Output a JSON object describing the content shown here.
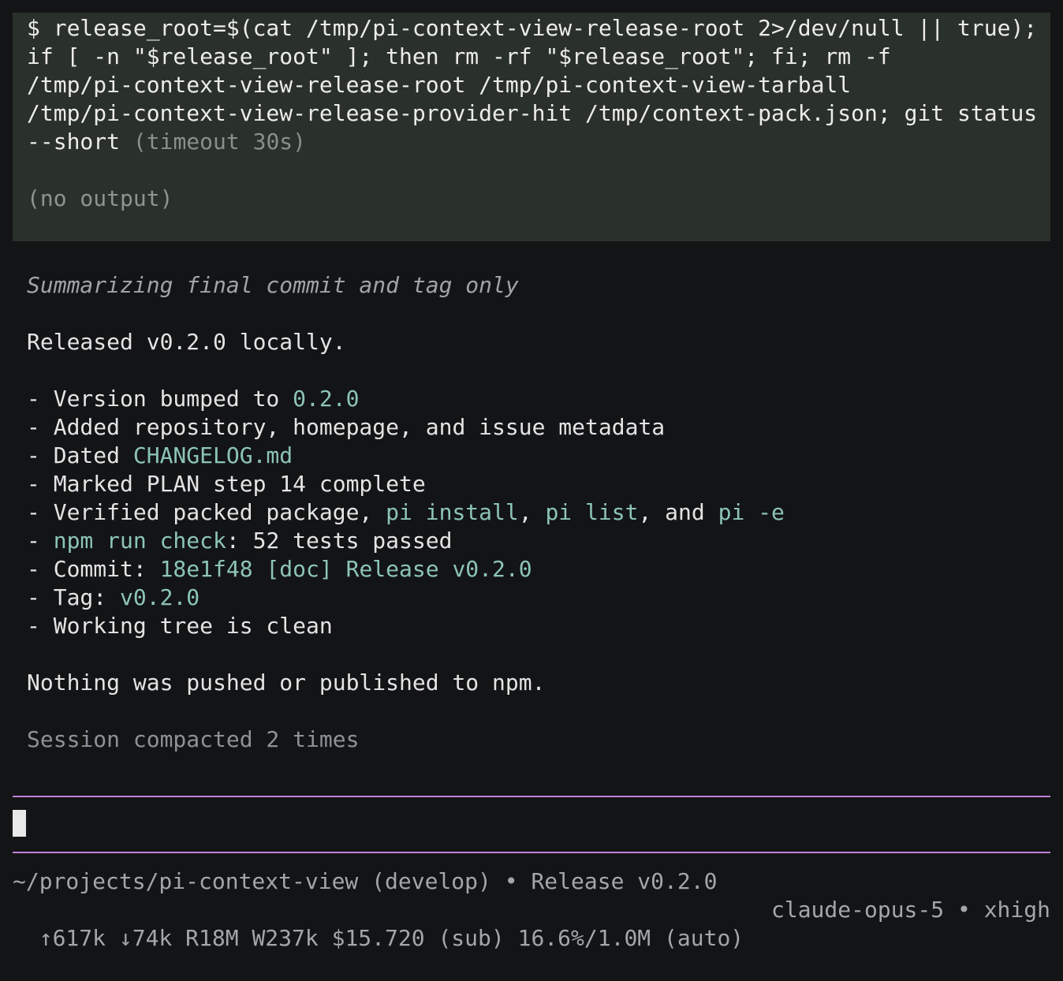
{
  "tool_call": {
    "command": "$ release_root=$(cat /tmp/pi-context-view-release-root 2>/dev/null || true); if [ -n \"$release_root\" ]; then rm -rf \"$release_root\"; fi; rm -f /tmp/pi-context-view-release-root /tmp/pi-context-view-tarball /tmp/pi-context-view-release-provider-hit /tmp/context-pack.json; git status --short",
    "command_lines": [
      "$ release_root=$(cat /tmp/pi-context-view-release-root 2>/dev/null || true);",
      "if [ -n \"$release_root\" ]; then rm -rf \"$release_root\"; fi; rm -f",
      "/tmp/pi-context-view-release-root /tmp/pi-context-view-tarball",
      "/tmp/pi-context-view-release-provider-hit /tmp/context-pack.json; git status",
      "--short"
    ],
    "timeout": "(timeout 30s)",
    "output": "(no output)"
  },
  "assistant": {
    "thinking": "Summarizing final commit and tag only",
    "intro": "Released v0.2.0 locally.",
    "bullets": {
      "b1": {
        "text": "- Version bumped to ",
        "code": "0.2.0"
      },
      "b2": {
        "text": "- Added repository, homepage, and issue metadata"
      },
      "b3": {
        "text": "- Dated ",
        "code": "CHANGELOG.md"
      },
      "b4": {
        "text": "- Marked PLAN step 14 complete"
      },
      "b5": {
        "text": "- Verified packed package, ",
        "code1": "pi install",
        "sep1": ", ",
        "code2": "pi list",
        "sep2": ", and ",
        "code3": "pi -e"
      },
      "b6": {
        "prefix": "- ",
        "code": "npm run check",
        "text": ": 52 tests passed"
      },
      "b7": {
        "text": "- Commit: ",
        "code": "18e1f48 [doc] Release v0.2.0"
      },
      "b8": {
        "text": "- Tag: ",
        "code": "v0.2.0"
      },
      "b9": {
        "text": "- Working tree is clean"
      }
    },
    "closing": "Nothing was pushed or published to npm."
  },
  "session_note": "Session compacted 2 times",
  "footer": {
    "path_line": "~/projects/pi-context-view (develop) • Release v0.2.0",
    "stats": "↑617k ↓74k R18M W237k $15.720 (sub) 16.6%/1.0M (auto)",
    "model": "claude-opus-5 • xhigh"
  },
  "colors": {
    "background": "#131416",
    "tool_block_bg": "#2a302a",
    "accent_code": "#8cc5b4",
    "editor_border": "#c27fd6",
    "muted_text": "#8e9196"
  }
}
